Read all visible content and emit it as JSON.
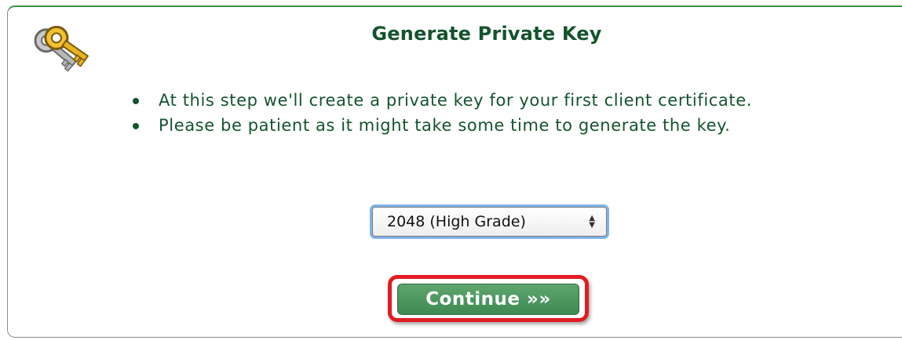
{
  "page": {
    "title": "Generate Private Key",
    "icon": "keys-icon"
  },
  "instructions": [
    "At this step we'll create a private key for your first client certificate.",
    "Please be patient as it might take some time to generate the key."
  ],
  "key_size_select": {
    "selected": "2048 (High Grade)"
  },
  "continue_button": {
    "label": "Continue »»"
  },
  "colors": {
    "title_text": "#14532d",
    "button_green": "#4a9a5e",
    "highlight_red": "#e21c23",
    "select_focus": "#7fb3ea"
  }
}
